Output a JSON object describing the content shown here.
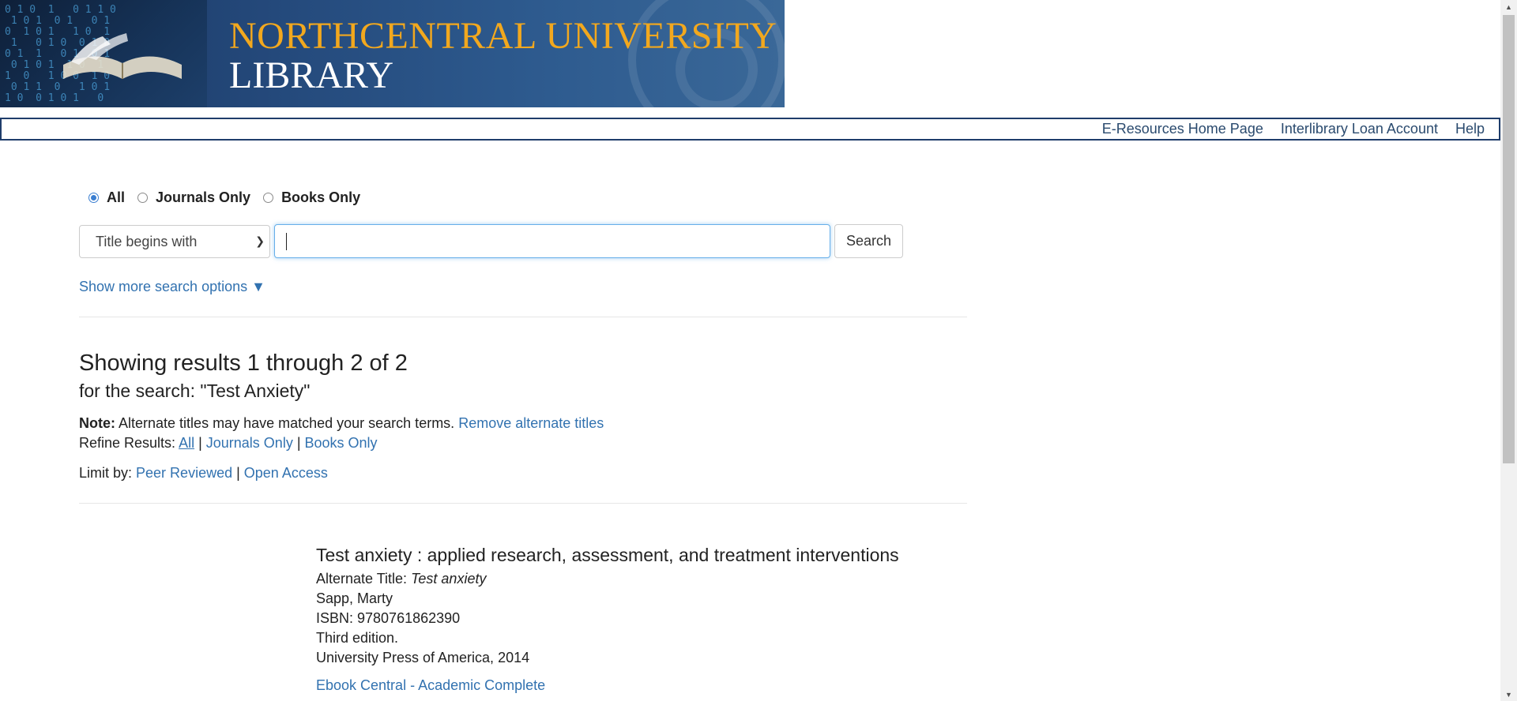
{
  "banner": {
    "title": "NORTHCENTRAL UNIVERSITY",
    "subtitle": "LIBRARY"
  },
  "topnav": {
    "items": [
      {
        "label": "E-Resources Home Page"
      },
      {
        "label": "Interlibrary Loan Account"
      },
      {
        "label": "Help"
      }
    ]
  },
  "search": {
    "scope_options": [
      {
        "label": "All",
        "checked": true
      },
      {
        "label": "Journals Only",
        "checked": false
      },
      {
        "label": "Books Only",
        "checked": false
      }
    ],
    "type_selected": "Title begins with",
    "query_value": "",
    "button_label": "Search",
    "more_options_label": "Show more search options ▼"
  },
  "results": {
    "heading": "Showing results 1 through 2 of 2",
    "subheading": "for the search: \"Test Anxiety\"",
    "note_label": "Note:",
    "note_text": " Alternate titles may have matched your search terms. ",
    "note_link": "Remove alternate titles",
    "refine_label": "Refine Results: ",
    "refine_all": "All",
    "refine_journals": "Journals Only",
    "refine_books": "Books Only",
    "separator": " | ",
    "limit_label": "Limit by: ",
    "limit_peer": "Peer Reviewed",
    "limit_open": "Open Access"
  },
  "items": [
    {
      "title": "Test anxiety : applied research, assessment, and treatment interventions",
      "alt_title_label": "Alternate Title: ",
      "alt_title": "Test anxiety",
      "author": "Sapp, Marty",
      "isbn": "ISBN: 9780761862390",
      "edition": "Third edition.",
      "publisher": "University Press of America, 2014",
      "link": "Ebook Central - Academic Complete"
    }
  ],
  "colors": {
    "link": "#3272b0",
    "nav_border": "#1f3d6b",
    "banner_title": "#f2a81e",
    "focus": "#66afe9"
  }
}
